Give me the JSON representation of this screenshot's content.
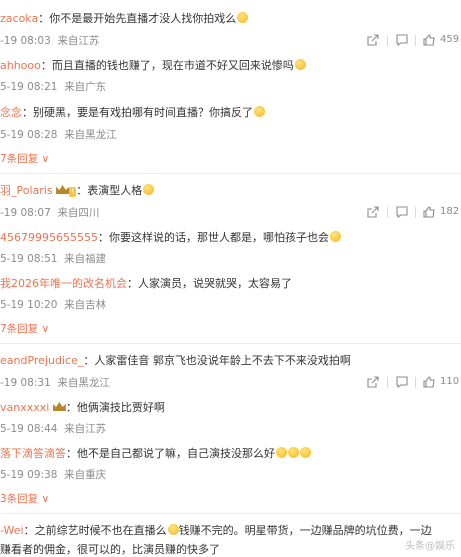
{
  "comments": [
    {
      "user": "zacoka",
      "text": "：你不是最开始先直播才没人找你拍戏么",
      "emoji": 1,
      "date": "-19 08:03",
      "loc": "来自江苏",
      "likes": "459"
    },
    {
      "user": "ahhooo",
      "text": "：而且直播的钱也赚了，现在市道不好又回来说惨吗",
      "emoji": 1,
      "date": "5-19 08:21",
      "loc": "来自广东"
    },
    {
      "user": "念念",
      "text": "：别硬黑，要是有戏拍哪有时间直播？你搞反了",
      "emoji": 1,
      "date": "5-19 08:28",
      "loc": "来自黑龙江"
    },
    {
      "user": "羽_Polaris",
      "text": "：表演型人格",
      "emoji": 1,
      "date": "-19 08:07",
      "loc": "来自四川",
      "likes": "182"
    },
    {
      "user": "45679995655555",
      "text": "：你要这样说的话，那世人都是，哪怕孩子也会",
      "emoji": 1,
      "date": "5-19 08:51",
      "loc": "来自福建"
    },
    {
      "user": "我2026年唯一的改名机会",
      "text": "：人家演员，说哭就哭，太容易了",
      "emoji": 0,
      "date": "5-19 10:20",
      "loc": "来自吉林"
    },
    {
      "user": "eandPrejudice_",
      "text": "：人家雷佳音 郭京飞也没说年龄上不去下不来没戏拍啊",
      "emoji": 0,
      "date": "-19 08:31",
      "loc": "来自黑龙江",
      "likes": "110"
    },
    {
      "user": "vanxxxxi",
      "text": "：他俩演技比贾好啊",
      "emoji": 0,
      "date": "5-19 08:44",
      "loc": "来自江苏"
    },
    {
      "user": "落下滴答滴答",
      "text": "：他不是自己都说了嘛，自己演技没那么好",
      "emoji": 3,
      "date": "5-19 09:38",
      "loc": "来自重庆"
    },
    {
      "user": "-Wei",
      "text": "：之前综艺时候不也在直播么",
      "text2": "钱赚不完的。明星带货，一边赚品牌的坑位费，一边",
      "line2": "赚看者的佣金，很可以的，比演员赚的快多了"
    }
  ],
  "replies_7": "7条回复",
  "replies_3": "3条回复",
  "watermark": "头条@娱乐"
}
